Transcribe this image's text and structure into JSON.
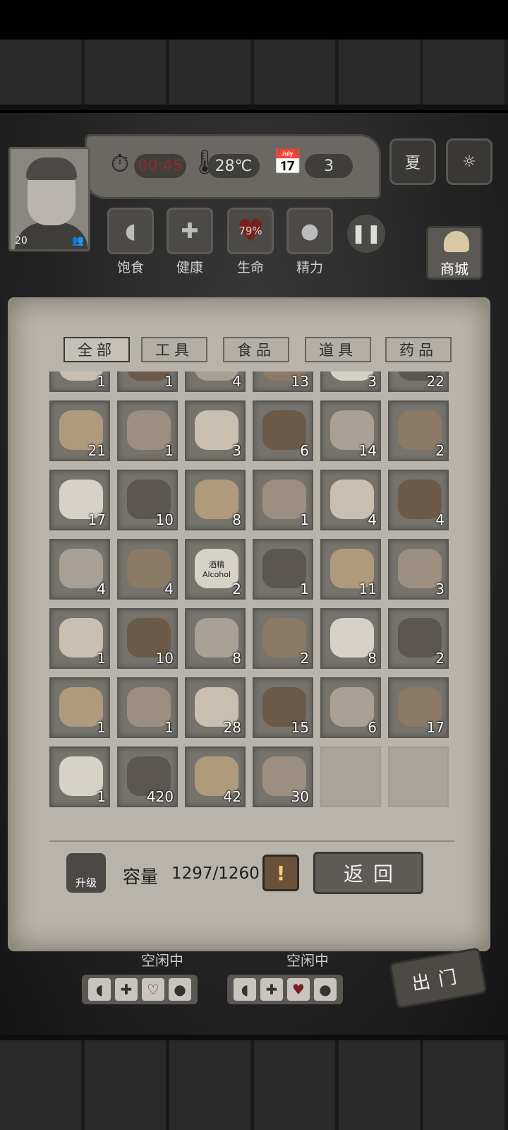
{
  "hud": {
    "portrait_level": "20",
    "timer": "00:45",
    "temperature": "28℃",
    "day": "3",
    "season": "夏",
    "stats": [
      {
        "label": "饱食",
        "icon": "stomach-icon"
      },
      {
        "label": "健康",
        "icon": "cross-icon"
      },
      {
        "label": "生命",
        "icon": "heart-icon",
        "value": "79%"
      },
      {
        "label": "精力",
        "icon": "person-icon"
      }
    ],
    "shop_label": "商城"
  },
  "tabs": [
    "全部",
    "工具",
    "食品",
    "道具",
    "药品"
  ],
  "active_tab": "全部",
  "items": [
    {
      "name": "shovel",
      "qty": "1"
    },
    {
      "name": "shell-dish",
      "qty": "1"
    },
    {
      "name": "rock-pile",
      "qty": "4"
    },
    {
      "name": "sticks",
      "qty": "13"
    },
    {
      "name": "rope",
      "qty": "3"
    },
    {
      "name": "planks",
      "qty": "22"
    },
    {
      "name": "stone",
      "qty": "21"
    },
    {
      "name": "leaf",
      "qty": "1"
    },
    {
      "name": "resin-branch",
      "qty": "3"
    },
    {
      "name": "wood-blocks",
      "qty": "6"
    },
    {
      "name": "boards",
      "qty": "14"
    },
    {
      "name": "board-panel",
      "qty": "2"
    },
    {
      "name": "nail",
      "qty": "17"
    },
    {
      "name": "arrows",
      "qty": "10"
    },
    {
      "name": "iron-ingots",
      "qty": "8"
    },
    {
      "name": "salt-crystal",
      "qty": "1"
    },
    {
      "name": "ore-rock",
      "qty": "4"
    },
    {
      "name": "worm",
      "qty": "4"
    },
    {
      "name": "animal-hide",
      "qty": "4"
    },
    {
      "name": "coal-rocks",
      "qty": "4"
    },
    {
      "name": "alcohol-bottle",
      "qty": "2",
      "label_top": "酒精",
      "label_bottom": "Alcohol"
    },
    {
      "name": "bread",
      "qty": "1"
    },
    {
      "name": "feather",
      "qty": "11"
    },
    {
      "name": "horn",
      "qty": "3"
    },
    {
      "name": "grain-bowl",
      "qty": "1"
    },
    {
      "name": "flour",
      "qty": "10"
    },
    {
      "name": "mushrooms",
      "qty": "8"
    },
    {
      "name": "treasure-chest",
      "qty": "2"
    },
    {
      "name": "bottle",
      "qty": "8"
    },
    {
      "name": "spear",
      "qty": "2"
    },
    {
      "name": "amulet",
      "qty": "1"
    },
    {
      "name": "wood-bundle",
      "qty": "1"
    },
    {
      "name": "gift-box-bread",
      "qty": "28"
    },
    {
      "name": "gift-box-medical",
      "qty": "15"
    },
    {
      "name": "gift-box-tools",
      "qty": "6"
    },
    {
      "name": "gift-box-weapons",
      "qty": "17"
    },
    {
      "name": "bow",
      "qty": "1"
    },
    {
      "name": "earthworm",
      "qty": "420"
    },
    {
      "name": "eel",
      "qty": "42"
    },
    {
      "name": "shrimp",
      "qty": "30"
    },
    {
      "name": "empty",
      "qty": ""
    },
    {
      "name": "empty",
      "qty": ""
    }
  ],
  "footer": {
    "upgrade_label": "升级",
    "capacity_label": "容量",
    "capacity_value": "1297/1260",
    "warn": "!",
    "back_label": "返回"
  },
  "survivors": [
    {
      "status": "空闲中"
    },
    {
      "status": "空闲中"
    }
  ],
  "exit_label": "出门"
}
